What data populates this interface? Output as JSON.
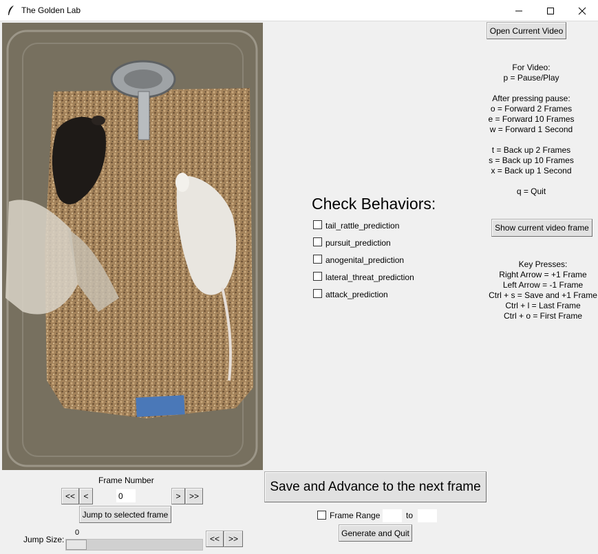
{
  "window": {
    "title": "The Golden Lab",
    "icon": "feather-icon",
    "controls": [
      "minimize-icon",
      "maximize-icon",
      "close-icon"
    ]
  },
  "video_panel": {
    "description_icon": "video-frame-image"
  },
  "open_video_button": "Open Current Video",
  "video_help": [
    "For Video:",
    "p = Pause/Play",
    "",
    "After pressing pause:",
    "o = Forward 2 Frames",
    "e = Forward 10 Frames",
    "w = Forward 1 Second",
    "",
    "t = Back up 2 Frames",
    "s = Back up 10 Frames",
    "x = Back up 1 Second",
    "",
    "q = Quit"
  ],
  "behaviors": {
    "heading": "Check Behaviors:",
    "items": [
      {
        "label": "tail_rattle_prediction",
        "checked": false
      },
      {
        "label": "pursuit_prediction",
        "checked": false
      },
      {
        "label": "anogenital_prediction",
        "checked": false
      },
      {
        "label": "lateral_threat_prediction",
        "checked": false
      },
      {
        "label": "attack_prediction",
        "checked": false
      }
    ]
  },
  "show_frame_button": "Show current video frame",
  "key_presses": [
    "Key Presses:",
    "Right Arrow = +1 Frame",
    "Left Arrow = -1 Frame",
    "Ctrl + s = Save and +1 Frame",
    "Ctrl + l = Last Frame",
    "Ctrl + o = First Frame"
  ],
  "frame_nav": {
    "label": "Frame Number",
    "first_button": "<<",
    "prev_button": "<",
    "frame_value": "0",
    "next_button": ">",
    "last_button": ">>",
    "jump_button": "Jump to selected frame"
  },
  "save_advance_button": "Save and Advance to the next frame",
  "frame_range": {
    "checkbox_label": "Frame Range",
    "checked": false,
    "start_value": "",
    "to_label": "to",
    "end_value": ""
  },
  "generate_quit_button": "Generate and Quit",
  "jump_size": {
    "label": "Jump Size:",
    "value": "0",
    "slider_fraction": 0,
    "back_button": "<<",
    "forward_button": ">>"
  }
}
